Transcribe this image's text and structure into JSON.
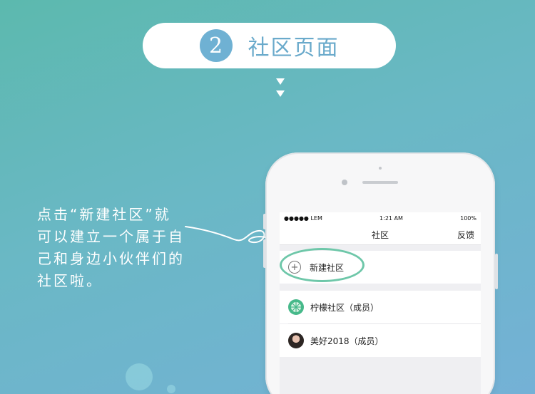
{
  "header": {
    "step_number": "2",
    "title": "社区页面"
  },
  "description": [
    "点击“新建社区”就",
    "可以建立一个属于自",
    "己和身边小伙伴们的",
    "社区啦。"
  ],
  "phone": {
    "status_bar": {
      "carrier": "●●●●● LEM",
      "time": "1:21 AM",
      "battery": "100%"
    },
    "nav": {
      "title": "社区",
      "right_button": "反馈"
    },
    "create_label": "新建社区",
    "communities": [
      {
        "name": "柠檬社区（成员）",
        "icon": "lemon-avatar"
      },
      {
        "name": "美好2018（成员）",
        "icon": "photo-avatar"
      }
    ]
  },
  "colors": {
    "accent": "#6fb1d3",
    "highlight": "#6ec7a9",
    "lemon": "#46b98a"
  }
}
